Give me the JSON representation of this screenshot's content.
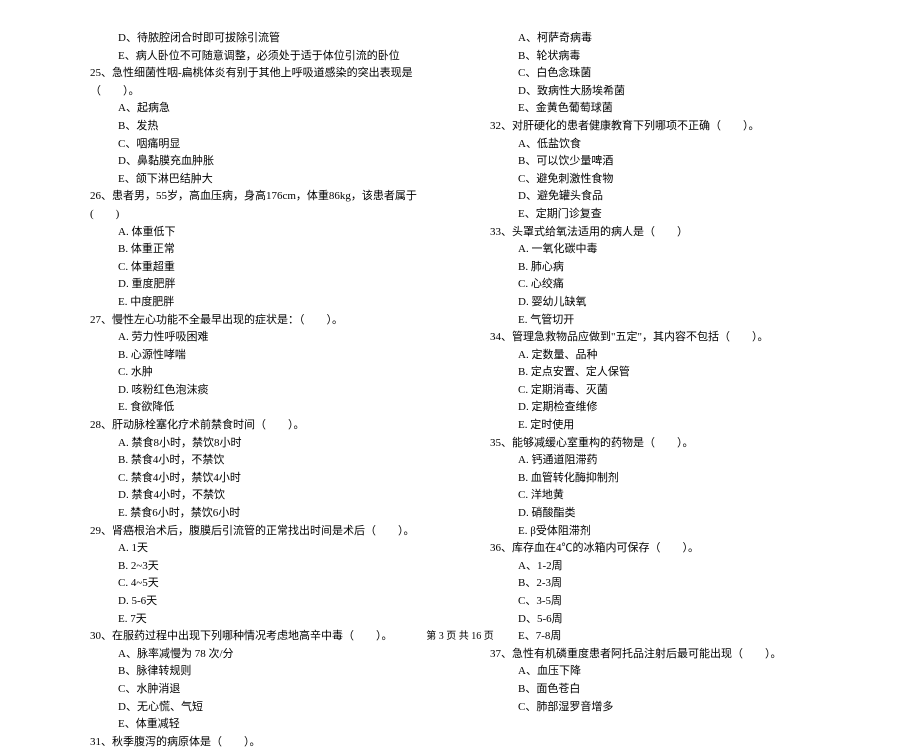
{
  "left": {
    "pre_opts": [
      "D、待脓腔闭合时即可拔除引流管",
      "E、病人卧位不可随意调整，必须处于适于体位引流的卧位"
    ],
    "q25": "25、急性细菌性咽-扁桃体炎有别于其他上呼吸道感染的突出表现是（　　）。",
    "q25_opts": [
      "A、起病急",
      "B、发热",
      "C、咽痛明显",
      "D、鼻黏膜充血肿胀",
      "E、颌下淋巴结肿大"
    ],
    "q26": "26、患者男，55岁，高血压病，身高176cm，体重86kg，该患者属于(　　)",
    "q26_opts": [
      "A. 体重低下",
      "B. 体重正常",
      "C. 体重超重",
      "D. 重度肥胖",
      "E. 中度肥胖"
    ],
    "q27": "27、慢性左心功能不全最早出现的症状是：（　　）。",
    "q27_opts": [
      "A. 劳力性呼吸困难",
      "B. 心源性哮喘",
      "C. 水肿",
      "D. 咳粉红色泡沫痰",
      "E. 食欲降低"
    ],
    "q28": "28、肝动脉栓塞化疗术前禁食时间（　　）。",
    "q28_opts": [
      "A. 禁食8小时，禁饮8小时",
      "B. 禁食4小时，不禁饮",
      "C. 禁食4小时，禁饮4小时",
      "D. 禁食4小时，不禁饮",
      "E. 禁食6小时，禁饮6小时"
    ],
    "q29": "29、肾癌根治术后，腹膜后引流管的正常找出时间是术后（　　）。",
    "q29_opts": [
      "A. 1天",
      "B. 2~3天",
      "C. 4~5天",
      "D. 5-6天",
      "E. 7天"
    ],
    "q30": "30、在服药过程中出现下列哪种情况考虑地高辛中毒（　　）。",
    "q30_opts": [
      "A、脉率减慢为 78 次/分",
      "B、脉律转规则",
      "C、水肿消退",
      "D、无心慌、气短",
      "E、体重减轻"
    ],
    "q31": "31、秋季腹泻的病原体是（　　）。"
  },
  "right": {
    "q31_opts": [
      "A、柯萨奇病毒",
      "B、轮状病毒",
      "C、白色念珠菌",
      "D、致病性大肠埃希菌",
      "E、金黄色葡萄球菌"
    ],
    "q32": "32、对肝硬化的患者健康教育下列哪项不正确（　　）。",
    "q32_opts": [
      "A、低盐饮食",
      "B、可以饮少量啤酒",
      "C、避免刺激性食物",
      "D、避免罐头食品",
      "E、定期门诊复查"
    ],
    "q33": "33、头罩式给氧法适用的病人是（　　）",
    "q33_opts": [
      "A. 一氧化碳中毒",
      "B. 肺心病",
      "C. 心绞痛",
      "D. 婴幼儿缺氧",
      "E. 气管切开"
    ],
    "q34": "34、管理急救物品应做到\"五定\"，其内容不包括（　　）。",
    "q34_opts": [
      "A. 定数量、品种",
      "B. 定点安置、定人保管",
      "C. 定期消毒、灭菌",
      "D. 定期检查维修",
      "E. 定时使用"
    ],
    "q35": "35、能够减缓心室重构的药物是（　　）。",
    "q35_opts": [
      "A. 钙通道阻滞药",
      "B. 血管转化酶抑制剂",
      "C. 洋地黄",
      "D. 硝酸酯类",
      "E. β受体阻滞剂"
    ],
    "q36": "36、库存血在4℃的冰箱内可保存（　　）。",
    "q36_opts": [
      "A、1-2周",
      "B、2-3周",
      "C、3-5周",
      "D、5-6周",
      "E、7-8周"
    ],
    "q37": "37、急性有机磷重度患者阿托品注射后最可能出现（　　）。",
    "q37_opts": [
      "A、血压下降",
      "B、面色苍白",
      "C、肺部湿罗音增多"
    ]
  },
  "footer": "第 3 页 共 16 页"
}
